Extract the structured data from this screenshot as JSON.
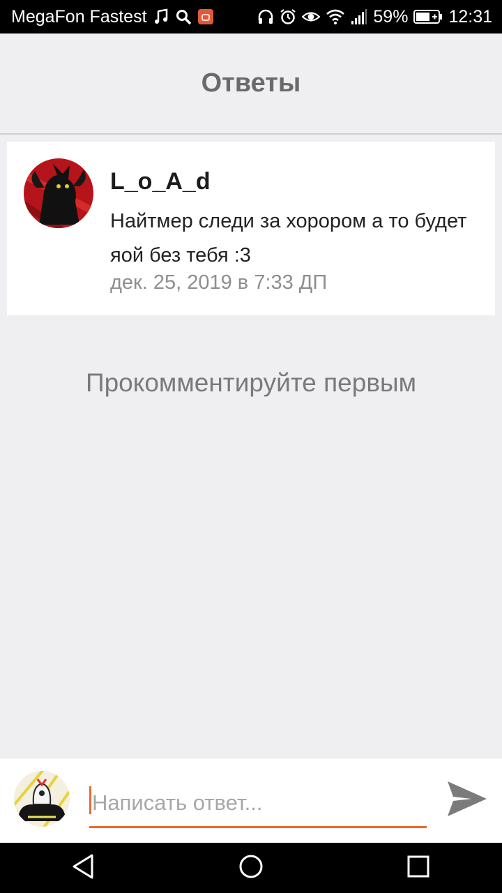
{
  "status_bar": {
    "carrier": "MegaFon Fastest",
    "battery": "59%",
    "time": "12:31",
    "left_icons": [
      "music-icon",
      "search-icon",
      "app-notification-icon"
    ],
    "right_icons": [
      "headphones-icon",
      "alarm-icon",
      "eye-icon",
      "wifi-icon",
      "signal-icon",
      "battery-icon"
    ]
  },
  "header": {
    "title": "Ответы"
  },
  "comment": {
    "author": "L_o_A_d",
    "text": "Найтмер следи за хорором а то будет яой без тебя :3",
    "date": "дек. 25, 2019 в 7:33 ДП"
  },
  "empty_state": "Прокомментируйте первым",
  "reply": {
    "placeholder": "Написать ответ..."
  },
  "colors": {
    "accent": "#ee6b28",
    "background": "#efeef0",
    "title": "#6a6a6a",
    "date": "#8e8e8e",
    "send_icon": "#7b7b7b"
  },
  "nav": {
    "icons": [
      "back-icon",
      "home-icon",
      "recents-icon"
    ]
  }
}
